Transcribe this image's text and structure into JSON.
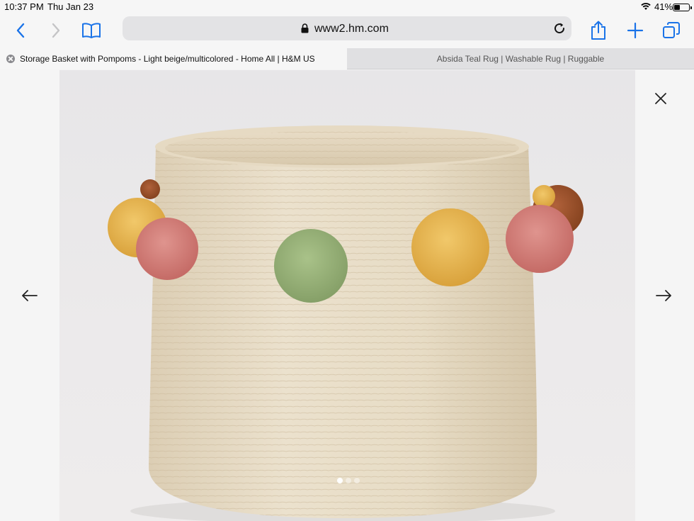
{
  "status": {
    "time": "10:37 PM",
    "date": "Thu Jan 23",
    "battery": "41%",
    "battery_level": 0.41
  },
  "toolbar": {
    "url": "www2.hm.com"
  },
  "tabs": [
    {
      "title": "Storage Basket with Pompoms - Light beige/multicolored - Home All | H&M US"
    },
    {
      "title": "Absida Teal Rug | Washable Rug | Ruggable"
    }
  ],
  "viewer": {
    "image_count": 3,
    "current_index": 0
  },
  "colors": {
    "accent": "#1a73e8",
    "basket": "#e8dcc6",
    "pompom_yellow": "#e6b54a",
    "pompom_pink": "#d47f7a",
    "pompom_green": "#9bb47a",
    "pompom_brown": "#9b4f26"
  }
}
